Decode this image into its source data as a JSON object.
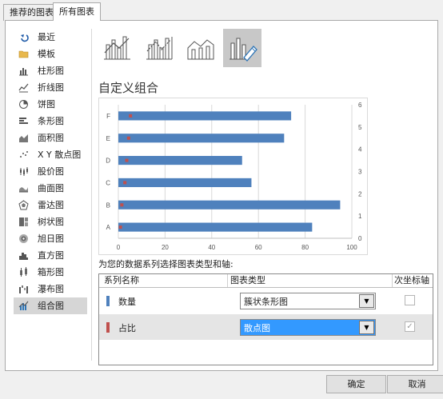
{
  "tabs": [
    "推荐的图表",
    "所有图表"
  ],
  "sidebar": [
    {
      "label": "最近",
      "icon": "undo-icon"
    },
    {
      "label": "模板",
      "icon": "folder-icon"
    },
    {
      "label": "柱形图",
      "icon": "column-chart-icon"
    },
    {
      "label": "折线图",
      "icon": "line-chart-icon"
    },
    {
      "label": "饼图",
      "icon": "pie-chart-icon"
    },
    {
      "label": "条形图",
      "icon": "bar-chart-icon"
    },
    {
      "label": "面积图",
      "icon": "area-chart-icon"
    },
    {
      "label": "X Y 散点图",
      "icon": "scatter-chart-icon"
    },
    {
      "label": "股价图",
      "icon": "stock-chart-icon"
    },
    {
      "label": "曲面图",
      "icon": "surface-chart-icon"
    },
    {
      "label": "雷达图",
      "icon": "radar-chart-icon"
    },
    {
      "label": "树状图",
      "icon": "treemap-chart-icon"
    },
    {
      "label": "旭日图",
      "icon": "sunburst-chart-icon"
    },
    {
      "label": "直方图",
      "icon": "histogram-chart-icon"
    },
    {
      "label": "箱形图",
      "icon": "boxplot-chart-icon"
    },
    {
      "label": "瀑布图",
      "icon": "waterfall-chart-icon"
    },
    {
      "label": "组合图",
      "icon": "combo-chart-icon"
    }
  ],
  "active_sidebar": "组合图",
  "subtypes": [
    "clustered-column-line-icon",
    "clustered-column-line-secondary-icon",
    "stacked-area-column-icon",
    "custom-combo-icon"
  ],
  "selected_subtype": 3,
  "section_title": "自定义组合",
  "prompt": "为您的数据系列选择图表类型和轴:",
  "table": {
    "headers": [
      "系列名称",
      "图表类型",
      "次坐标轴"
    ],
    "rows": [
      {
        "name": "数量",
        "color": "#4f81bd",
        "chart_type": "簇状条形图",
        "secondary": false
      },
      {
        "name": "占比",
        "color": "#c0504d",
        "chart_type": "散点图",
        "secondary": true
      }
    ]
  },
  "buttons": {
    "ok": "确定",
    "cancel": "取消"
  },
  "chart_data": {
    "type": "bar",
    "orientation": "horizontal",
    "categories": [
      "A",
      "B",
      "C",
      "D",
      "E",
      "F"
    ],
    "series": [
      {
        "values": [
          83,
          95,
          57,
          53,
          71,
          74
        ],
        "color": "#4f81bd"
      },
      {
        "type": "scatter",
        "x": [
          0.9,
          1.5,
          2.8,
          3.6,
          4.4,
          5.2
        ],
        "y": [
          0.5,
          1.5,
          2.5,
          3.5,
          4.5,
          5.5
        ],
        "color": "#c0504d"
      }
    ],
    "xlim": [
      0,
      100
    ],
    "xticks": [
      "0",
      "20",
      "40",
      "60",
      "80",
      "100"
    ],
    "secondary_ylim": [
      0,
      6
    ],
    "secondary_yticks": [
      "0",
      "1",
      "2",
      "3",
      "4",
      "5",
      "6"
    ],
    "grid": true
  }
}
